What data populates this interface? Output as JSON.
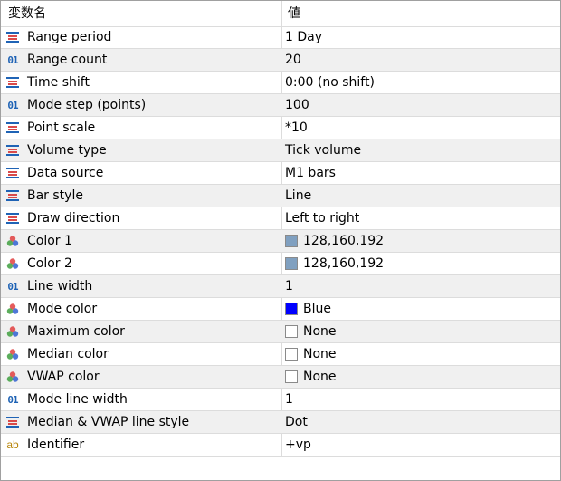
{
  "header": {
    "name_col": "変数名",
    "value_col": "値"
  },
  "rows": [
    {
      "icon": "enum-icon",
      "name": "Range period",
      "value": "1 Day"
    },
    {
      "icon": "integer-icon",
      "name": "Range count",
      "value": "20"
    },
    {
      "icon": "enum-icon",
      "name": "Time shift",
      "value": "0:00 (no shift)"
    },
    {
      "icon": "integer-icon",
      "name": "Mode step (points)",
      "value": "100"
    },
    {
      "icon": "enum-icon",
      "name": "Point scale",
      "value": "*10"
    },
    {
      "icon": "enum-icon",
      "name": "Volume type",
      "value": "Tick volume"
    },
    {
      "icon": "enum-icon",
      "name": "Data source",
      "value": "M1 bars"
    },
    {
      "icon": "enum-icon",
      "name": "Bar style",
      "value": "Line"
    },
    {
      "icon": "enum-icon",
      "name": "Draw direction",
      "value": "Left to right"
    },
    {
      "icon": "color-icon",
      "name": "Color 1",
      "value": "128,160,192",
      "swatch": "#80a0c0"
    },
    {
      "icon": "color-icon",
      "name": "Color 2",
      "value": "128,160,192",
      "swatch": "#80a0c0"
    },
    {
      "icon": "integer-icon",
      "name": "Line width",
      "value": "1"
    },
    {
      "icon": "color-icon",
      "name": "Mode color",
      "value": "Blue",
      "swatch": "#0000ff"
    },
    {
      "icon": "color-icon",
      "name": "Maximum color",
      "value": "None",
      "swatch": "#ffffff"
    },
    {
      "icon": "color-icon",
      "name": "Median color",
      "value": "None",
      "swatch": "#ffffff"
    },
    {
      "icon": "color-icon",
      "name": "VWAP color",
      "value": "None",
      "swatch": "#ffffff"
    },
    {
      "icon": "integer-icon",
      "name": "Mode line width",
      "value": "1"
    },
    {
      "icon": "enum-icon",
      "name": "Median & VWAP line style",
      "value": "Dot"
    },
    {
      "icon": "string-icon",
      "name": "Identifier",
      "value": "+vp"
    }
  ],
  "icon_glyphs": {
    "integer": "01",
    "string": "ab"
  }
}
